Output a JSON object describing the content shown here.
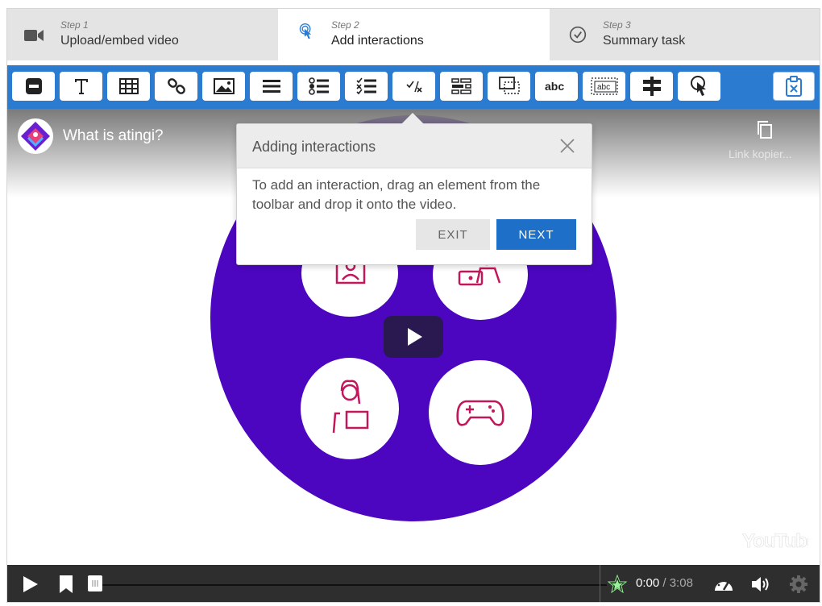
{
  "steps": [
    {
      "num": "Step 1",
      "label": "Upload/embed video",
      "icon": "video-camera-icon"
    },
    {
      "num": "Step 2",
      "label": "Add interactions",
      "icon": "touch-pointer-icon"
    },
    {
      "num": "Step 3",
      "label": "Summary task",
      "icon": "check-circle-icon"
    }
  ],
  "toolbar": {
    "tools": [
      "label-tool",
      "text-tool",
      "table-tool",
      "link-tool",
      "image-tool",
      "statements-tool",
      "single-choice-tool",
      "multiple-choice-tool",
      "true-false-tool",
      "drag-and-drop-tool",
      "crossroads-tool",
      "fill-in-blanks-tool",
      "drag-text-tool",
      "navigation-hotspot-tool",
      "mark-the-words-tool"
    ],
    "clipboard_icon": "clipboard-icon",
    "tool_text": "abc"
  },
  "video": {
    "title": "What is atingi?",
    "copy_link": "Link kopier...",
    "brand": "YouTube"
  },
  "popover": {
    "title": "Adding interactions",
    "body": "To add an interaction, drag an element from the toolbar and drop it onto the video.",
    "exit": "EXIT",
    "next": "NEXT"
  },
  "player": {
    "current": "0:00",
    "separator": " / ",
    "total": "3:08"
  },
  "colors": {
    "toolbar": "#2b7bd1",
    "purple": "#4d06c0",
    "next_button": "#1d6fc7",
    "icon_pink": "#c2185b"
  }
}
